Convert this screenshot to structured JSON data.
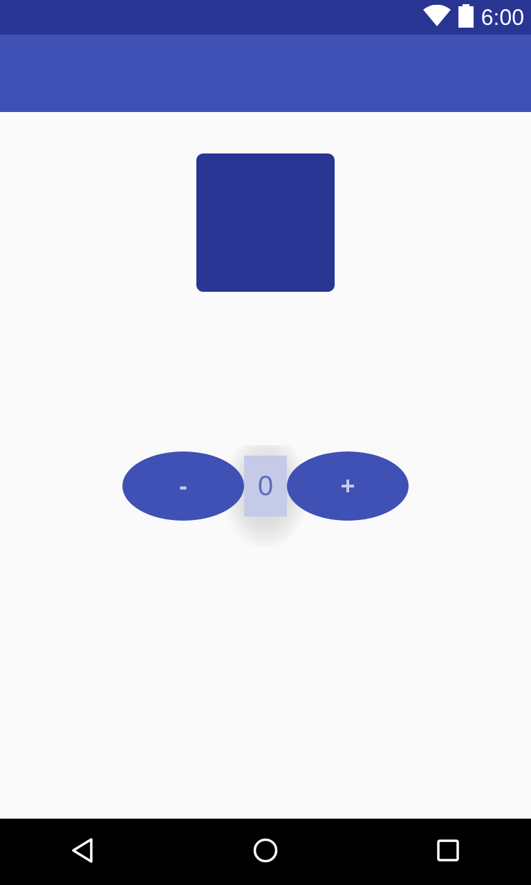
{
  "status_bar": {
    "time": "6:00",
    "icons": [
      "wifi-icon",
      "battery-icon"
    ]
  },
  "colors": {
    "status_bar": "#283593",
    "app_bar": "#3f51b5",
    "square": "#283593",
    "button": "#3f51b5",
    "button_text": "#c5cae9",
    "counter_bg": "#c5cae9",
    "counter_text": "#5c6bc0",
    "background": "#fafafa"
  },
  "controls": {
    "decrement_label": "-",
    "increment_label": "+",
    "counter_value": "0"
  },
  "nav_bar": {
    "icons": [
      "back-icon",
      "home-icon",
      "recents-icon"
    ]
  }
}
